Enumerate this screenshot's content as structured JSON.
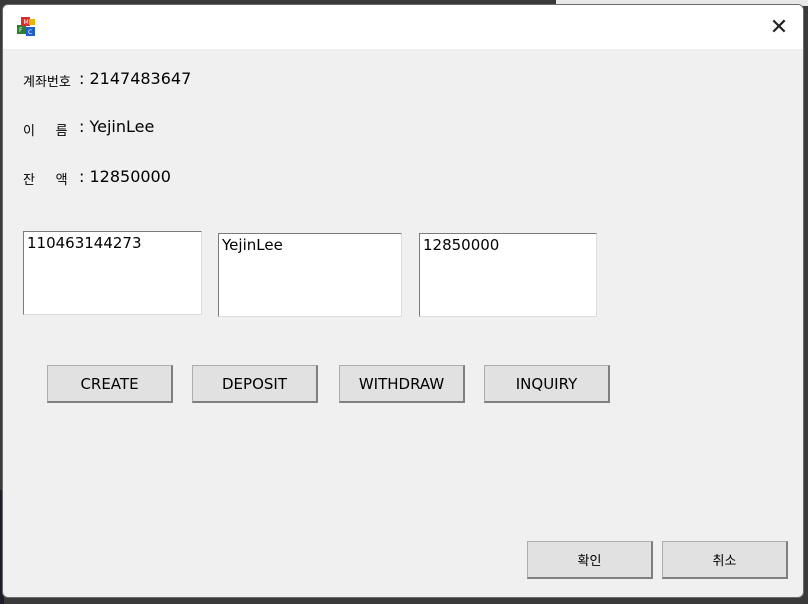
{
  "window": {
    "title": "",
    "close_glyph": "✕"
  },
  "fields": {
    "account_label": "계좌번호",
    "account_value": ": 2147483647",
    "name_label": "이     름",
    "name_value": ": YejinLee",
    "balance_label": "잔     액",
    "balance_value": ": 12850000"
  },
  "inputs": {
    "account_number": "110463144273",
    "name": "YejinLee",
    "amount": "12850000"
  },
  "buttons": {
    "create": "CREATE",
    "deposit": "DEPOSIT",
    "withdraw": "WITHDRAW",
    "inquiry": "INQUIRY",
    "ok": "확인",
    "cancel": "취소"
  },
  "icons": {
    "app": "mfc-app-icon",
    "close": "close-icon"
  }
}
